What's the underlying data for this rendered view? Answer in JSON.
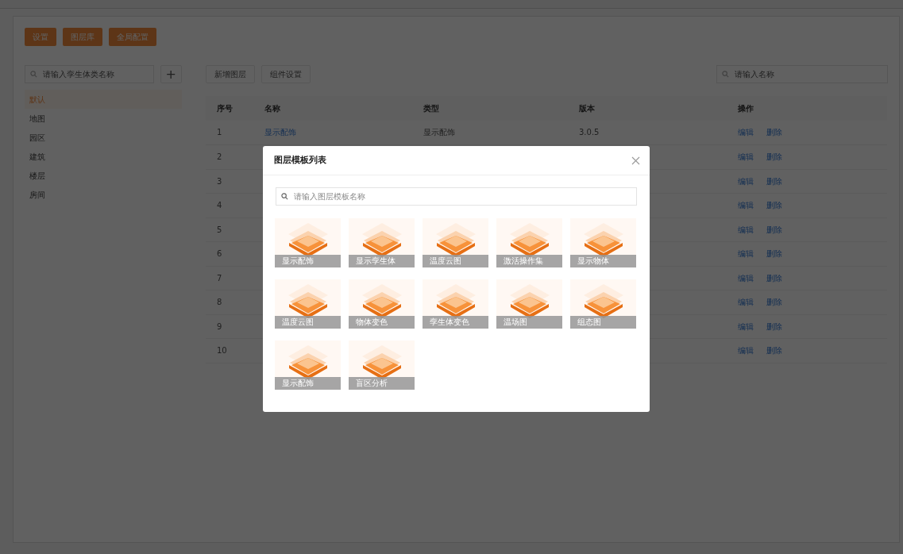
{
  "top_buttons": [
    "设置",
    "图层库",
    "全局配置"
  ],
  "sidebar": {
    "search": {
      "placeholder": "请输入孪生体类名称"
    },
    "add_button": "+",
    "items": [
      {
        "label": "默认",
        "selected": true
      },
      {
        "label": "地图",
        "selected": false
      },
      {
        "label": "园区",
        "selected": false
      },
      {
        "label": "建筑",
        "selected": false
      },
      {
        "label": "楼层",
        "selected": false
      },
      {
        "label": "房间",
        "selected": false
      }
    ]
  },
  "toolbar": {
    "buttons": [
      "新增图层",
      "组件设置"
    ],
    "search": {
      "placeholder": "请输入名称"
    }
  },
  "table": {
    "columns": [
      "序号",
      "名称",
      "类型",
      "版本",
      "操作"
    ],
    "rows": [
      {
        "index": "1",
        "name": "显示配饰",
        "type": "显示配饰",
        "version": "3.0.5",
        "actions": [
          "编辑",
          "删除"
        ]
      },
      {
        "index": "2",
        "actions": [
          "编辑",
          "删除"
        ]
      },
      {
        "index": "3",
        "actions": [
          "编辑",
          "删除"
        ]
      },
      {
        "index": "4",
        "actions": [
          "编辑",
          "删除"
        ]
      },
      {
        "index": "5",
        "actions": [
          "编辑",
          "删除"
        ]
      },
      {
        "index": "6",
        "actions": [
          "编辑",
          "删除"
        ]
      },
      {
        "index": "7",
        "actions": [
          "编辑",
          "删除"
        ]
      },
      {
        "index": "8",
        "actions": [
          "编辑",
          "删除"
        ]
      },
      {
        "index": "9",
        "actions": [
          "编辑",
          "删除"
        ]
      },
      {
        "index": "10",
        "actions": [
          "编辑",
          "删除"
        ]
      }
    ]
  },
  "modal": {
    "title": "图层模板列表",
    "search": {
      "placeholder": "请输入图层模板名称"
    },
    "templates": [
      "显示配饰",
      "显示孪生体",
      "温度云图",
      "激活操作集",
      "显示物体",
      "温度云图",
      "物体变色",
      "孪生体变色",
      "温场图",
      "组态图",
      "显示配饰",
      "盲区分析"
    ]
  }
}
